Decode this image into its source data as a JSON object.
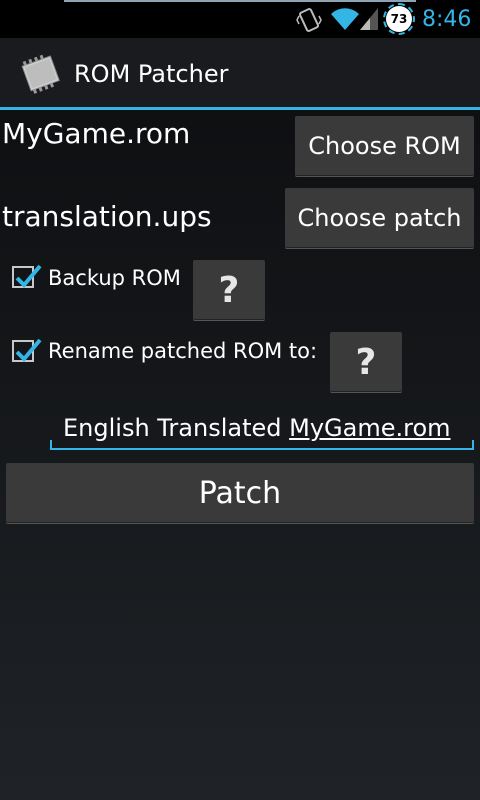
{
  "status_bar": {
    "battery_level": "73",
    "time": "8:46",
    "icons": [
      "vibrate-icon",
      "wifi-icon",
      "signal-icon",
      "battery-icon"
    ]
  },
  "action_bar": {
    "title": "ROM Patcher",
    "icon": "chip-icon",
    "accent_color": "#33b5e5"
  },
  "rom": {
    "filename": "MyGame.rom",
    "button_label": "Choose ROM"
  },
  "patch": {
    "filename": "translation.ups",
    "button_label": "Choose patch"
  },
  "options": {
    "backup": {
      "label": "Backup ROM",
      "checked": true,
      "help_label": "?"
    },
    "rename": {
      "label": "Rename patched ROM to:",
      "checked": true,
      "help_label": "?"
    }
  },
  "rename_field": {
    "prefix": "English Translated ",
    "filename": "MyGame.rom"
  },
  "patch_button": {
    "label": "Patch"
  }
}
